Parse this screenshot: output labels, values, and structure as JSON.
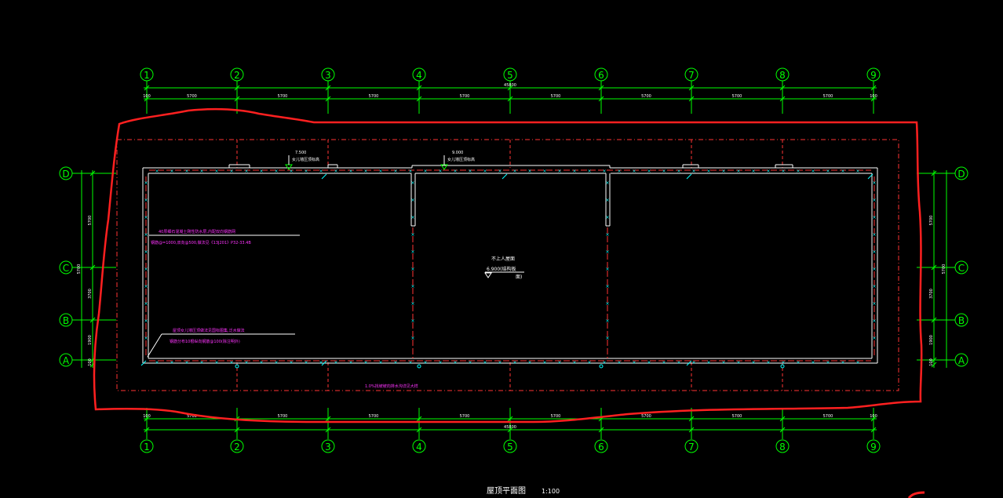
{
  "drawing": {
    "title": "屋顶平面图",
    "scale": "1:100",
    "colors": {
      "background": "#000000",
      "axis": "#00ff00",
      "dimension": "#00ff00",
      "wall": "#ffffff",
      "dashed": "#ff3333",
      "annotation": "#ff33ff",
      "markup": "#ff2020",
      "marker": "#00ffff",
      "parapet_slash": "#00ffff",
      "text_white": "#ffffff"
    },
    "grid_columns": [
      "1",
      "2",
      "3",
      "4",
      "5",
      "6",
      "7",
      "8",
      "9"
    ],
    "grid_rows": [
      "D",
      "C",
      "B",
      "A"
    ],
    "top_dimensions": {
      "total": "45800",
      "end_left": "100",
      "end_right": "100",
      "segments": [
        "5700",
        "5700",
        "5700",
        "5700",
        "5700",
        "5700",
        "5700",
        "5700"
      ]
    },
    "bottom_dimensions": {
      "total": "45800",
      "end_left": "100",
      "end_right": "100",
      "segments": [
        "5700",
        "5700",
        "5700",
        "5700",
        "5700",
        "5700",
        "5700",
        "5700"
      ]
    },
    "left_dimensions": {
      "total": "5700",
      "segments": [
        "5700",
        "3700",
        "1900",
        "100"
      ]
    },
    "right_dimensions": {
      "total": "5700",
      "segments": [
        "5700",
        "3700",
        "1900",
        "100"
      ]
    },
    "annotations": [
      {
        "id": "note_top_left_1",
        "text": "40厚细石混凝土刚性防水层,内配双向钢筋网",
        "color_key": "annotation"
      },
      {
        "id": "note_top_left_2",
        "text": "钢筋@=1000,双向@500,做法见《13J201》P32-33.4B",
        "color_key": "annotation"
      },
      {
        "id": "note_bottom_left_1",
        "text": "屋顶女儿墙压顶做法见国标图集,泛水做法",
        "color_key": "annotation"
      },
      {
        "id": "note_bottom_left_2",
        "text": "钢筋分布10根纵向钢筋@100(除注明外)",
        "color_key": "annotation"
      },
      {
        "id": "note_bottom_center",
        "text": "1.0%找坡坡向排水沟详见大样",
        "color_key": "annotation"
      },
      {
        "id": "elev_1",
        "text": "7.500",
        "color_key": "text_white"
      },
      {
        "id": "elev_1_label",
        "text": "女儿墙压顶标高",
        "color_key": "text_white"
      },
      {
        "id": "elev_2",
        "text": "9.000",
        "color_key": "text_white"
      },
      {
        "id": "elev_2_label",
        "text": "女儿墙压顶标高",
        "color_key": "text_white"
      },
      {
        "id": "roof_label",
        "text": "不上人屋面",
        "color_key": "text_white"
      },
      {
        "id": "roof_elev",
        "text": "6.900(结构板",
        "color_key": "text_white"
      },
      {
        "id": "roof_elev_2",
        "text": "面)",
        "color_key": "text_white"
      }
    ]
  }
}
